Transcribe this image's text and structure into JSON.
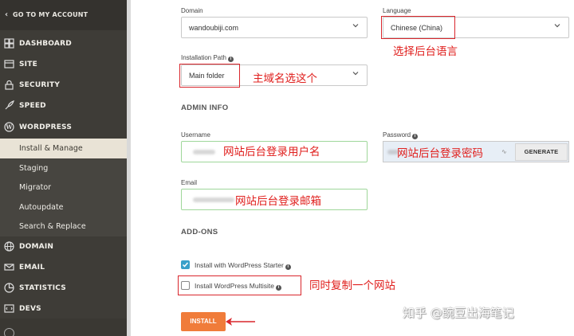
{
  "sidebar": {
    "goto_account": "GO TO MY ACCOUNT",
    "items": [
      {
        "label": "DASHBOARD",
        "icon": "dashboard-icon"
      },
      {
        "label": "SITE",
        "icon": "site-icon"
      },
      {
        "label": "SECURITY",
        "icon": "lock-icon"
      },
      {
        "label": "SPEED",
        "icon": "rocket-icon"
      },
      {
        "label": "WORDPRESS",
        "icon": "wordpress-icon"
      },
      {
        "label": "DOMAIN",
        "icon": "globe-icon"
      },
      {
        "label": "EMAIL",
        "icon": "mail-icon"
      },
      {
        "label": "STATISTICS",
        "icon": "statistics-icon"
      },
      {
        "label": "DEVS",
        "icon": "code-icon"
      }
    ],
    "wordpress_sub": [
      {
        "label": "Install & Manage",
        "active": true
      },
      {
        "label": "Staging",
        "active": false
      },
      {
        "label": "Migrator",
        "active": false
      },
      {
        "label": "Autoupdate",
        "active": false
      },
      {
        "label": "Search & Replace",
        "active": false
      }
    ]
  },
  "form": {
    "domain_label": "Domain",
    "domain_value": "wandoubiji.com",
    "language_label": "Language",
    "language_value": "Chinese (China)",
    "install_path_label": "Installation Path",
    "install_path_value": "Main folder",
    "admin_info_heading": "ADMIN INFO",
    "username_label": "Username",
    "password_label": "Password",
    "generate_label": "GENERATE",
    "email_label": "Email",
    "addons_heading": "ADD-ONS",
    "addon_starter_label": "Install with WordPress Starter",
    "addon_starter_checked": true,
    "addon_multisite_label": "Install WordPress Multisite",
    "addon_multisite_checked": false,
    "install_label": "INSTALL"
  },
  "annotations": {
    "language_note": "选择后台语言",
    "path_note": "主域名选这个",
    "username_note": "网站后台登录用户名",
    "password_note": "网站后台登录密码",
    "email_note": "网站后台登录邮箱",
    "multisite_note": "同时复制一个网站"
  },
  "watermark": "知乎 @豌豆出海笔记",
  "colors": {
    "sidebar_bg": "#3e3c37",
    "active_sub_bg": "#e9e3d6",
    "accent_orange": "#f07c3a",
    "annotation_red": "#e0201e",
    "checkbox_blue": "#3aa0c9"
  }
}
